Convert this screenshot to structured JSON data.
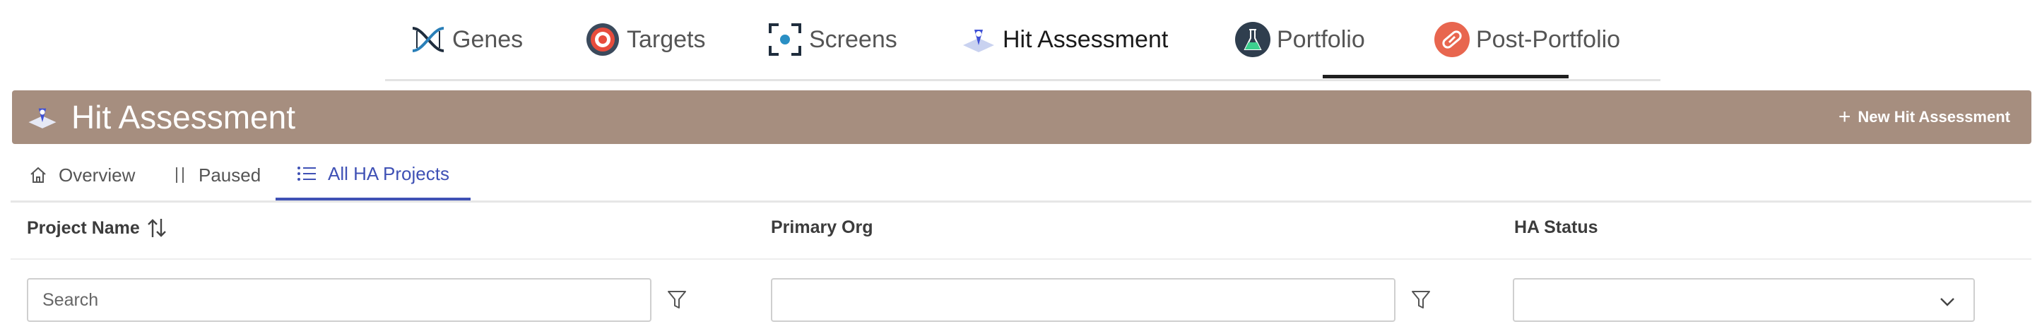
{
  "nav": {
    "items": [
      {
        "label": "Genes",
        "icon": "dna-icon"
      },
      {
        "label": "Targets",
        "icon": "target-icon"
      },
      {
        "label": "Screens",
        "icon": "screen-scan-icon"
      },
      {
        "label": "Hit Assessment",
        "icon": "hit-assessment-icon",
        "active": true
      },
      {
        "label": "Portfolio",
        "icon": "flask-icon"
      },
      {
        "label": "Post-Portfolio",
        "icon": "pill-icon"
      }
    ]
  },
  "header": {
    "title": "Hit Assessment",
    "new_button_label": "New Hit Assessment",
    "background_color": "#a68e7f"
  },
  "subtabs": {
    "items": [
      {
        "label": "Overview",
        "icon": "home-icon"
      },
      {
        "label": "Paused",
        "icon": "pause-icon"
      },
      {
        "label": "All HA Projects",
        "icon": "list-icon",
        "active": true
      }
    ],
    "active_color": "#3f51b5"
  },
  "table": {
    "columns": [
      {
        "label": "Project Name",
        "sortable": true
      },
      {
        "label": "Primary Org"
      },
      {
        "label": "HA Status"
      }
    ],
    "filters": {
      "project_name_placeholder": "Search",
      "primary_org_value": "",
      "ha_status_value": ""
    }
  }
}
